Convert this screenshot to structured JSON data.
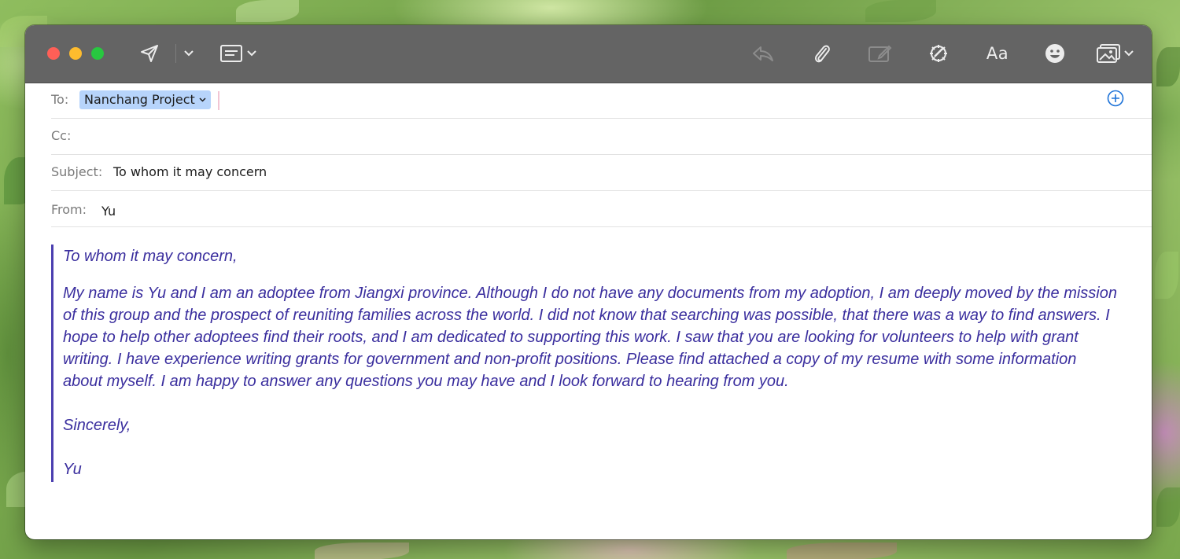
{
  "toolbar": {
    "icons": [
      "send-icon",
      "send-dropdown-chevron-icon",
      "header-fields-icon",
      "reply-icon",
      "attachment-icon",
      "markup-icon",
      "writing-tools-icon",
      "format-icon",
      "emoji-icon",
      "photo-browser-icon"
    ],
    "format_label": "Aa"
  },
  "header": {
    "to_label": "To:",
    "to_recipient": "Nanchang Project",
    "cc_label": "Cc:",
    "subject_label": "Subject:",
    "subject_value": "To whom it may concern",
    "from_label": "From:",
    "from_value": "Yu"
  },
  "message": {
    "greeting": "To whom it may concern,",
    "paragraph": "My name is Yu and I am an adoptee from Jiangxi province. Although I do not have any documents from my adoption, I am deeply moved by the mission of this group and the prospect of reuniting families across the world. I did not know that searching was possible, that there was a way to find answers. I hope to help other adoptees find their roots, and I am dedicated to supporting this work. I saw that you are looking for volunteers to help with grant writing. I have experience writing grants for government and non-profit positions. Please find attached a copy of my resume with some information about myself. I am happy to answer any questions you may have and I look forward to hearing from you.",
    "closing": "Sincerely,",
    "signature": "Yu"
  },
  "colors": {
    "toolbar_bg": "#646464",
    "token_bg": "#b7d4fb",
    "quote_text": "#3a2e9e",
    "quote_bar": "#4b3fb0",
    "add_button": "#1e73d8"
  }
}
